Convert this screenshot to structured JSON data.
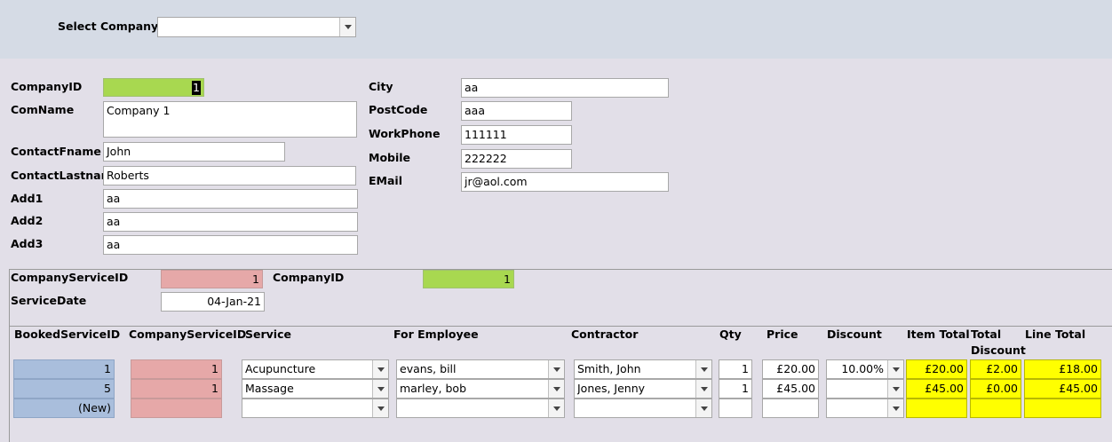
{
  "header": {
    "select_company_label": "Select Company",
    "select_company_value": "",
    "accent": "#ffff00"
  },
  "company": {
    "labels": {
      "company_id": "CompanyID",
      "com_name": "ComName",
      "contact_fname": "ContactFname",
      "contact_lastname": "ContactLastnam",
      "add1": "Add1",
      "add2": "Add2",
      "add3": "Add3",
      "city": "City",
      "postcode": "PostCode",
      "workphone": "WorkPhone",
      "mobile": "Mobile",
      "email": "EMail"
    },
    "values": {
      "company_id": "1",
      "com_name": "Company 1",
      "contact_fname": "John",
      "contact_lastname": "Roberts",
      "add1": "aa",
      "add2": "aa",
      "add3": "aa",
      "city": "aa",
      "postcode": "aaa",
      "workphone": "111111",
      "mobile": "222222",
      "email": "jr@aol.com"
    }
  },
  "service": {
    "labels": {
      "company_service_id": "CompanyServiceID",
      "company_id": "CompanyID",
      "service_date": "ServiceDate"
    },
    "values": {
      "company_service_id": "1",
      "company_id": "1",
      "service_date": "04-Jan-21"
    }
  },
  "booked": {
    "columns": {
      "booked_service_id": "BookedServiceID",
      "company_service_id": "CompanyServiceID",
      "service": "Service",
      "for_employee": "For Employee",
      "contractor": "Contractor",
      "qty": "Qty",
      "price": "Price",
      "discount": "Discount",
      "item_total": "Item Total",
      "total_discount_1": "Total",
      "total_discount_2": "Discount",
      "line_total": "Line Total"
    },
    "rows": [
      {
        "booked_service_id": "1",
        "company_service_id": "1",
        "service": "Acupuncture",
        "for_employee": "evans, bill",
        "contractor": "Smith, John",
        "qty": "1",
        "price": "£20.00",
        "discount": "10.00%",
        "item_total": "£20.00",
        "total_discount": "£2.00",
        "line_total": "£18.00"
      },
      {
        "booked_service_id": "5",
        "company_service_id": "1",
        "service": "Massage",
        "for_employee": "marley, bob",
        "contractor": "Jones, Jenny",
        "qty": "1",
        "price": "£45.00",
        "discount": "",
        "item_total": "£45.00",
        "total_discount": "£0.00",
        "line_total": "£45.00"
      },
      {
        "booked_service_id": "(New)",
        "company_service_id": "",
        "service": "",
        "for_employee": "",
        "contractor": "",
        "qty": "",
        "price": "",
        "discount": "",
        "item_total": "",
        "total_discount": "",
        "line_total": ""
      }
    ]
  }
}
